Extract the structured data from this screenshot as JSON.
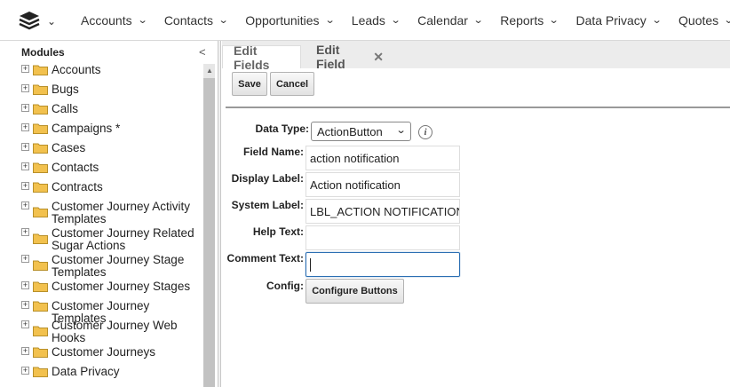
{
  "topnav": {
    "items": [
      {
        "label": "Accounts"
      },
      {
        "label": "Contacts"
      },
      {
        "label": "Opportunities"
      },
      {
        "label": "Leads"
      },
      {
        "label": "Calendar"
      },
      {
        "label": "Reports"
      },
      {
        "label": "Data Privacy"
      },
      {
        "label": "Quotes"
      }
    ],
    "logo_icon": "stack-layers-icon"
  },
  "modules": {
    "header": "Modules",
    "collapse_glyph": "<",
    "items": [
      {
        "label": "Accounts"
      },
      {
        "label": "Bugs"
      },
      {
        "label": "Calls"
      },
      {
        "label": "Campaigns *"
      },
      {
        "label": "Cases"
      },
      {
        "label": "Contacts"
      },
      {
        "label": "Contracts"
      },
      {
        "label": "Customer Journey Activity Templates"
      },
      {
        "label": "Customer Journey Related Sugar Actions"
      },
      {
        "label": "Customer Journey Stage Templates"
      },
      {
        "label": "Customer Journey Stages"
      },
      {
        "label": "Customer Journey Templates"
      },
      {
        "label": "Customer Journey Web Hooks"
      },
      {
        "label": "Customer Journeys"
      },
      {
        "label": "Data Privacy"
      }
    ]
  },
  "tabs": {
    "edit_fields": "Edit Fields",
    "edit_field": "Edit Field",
    "close_glyph": "✕"
  },
  "toolbar": {
    "save_label": "Save",
    "cancel_label": "Cancel"
  },
  "form": {
    "data_type": {
      "label": "Data Type:",
      "value": "ActionButton"
    },
    "field_name": {
      "label": "Field Name:",
      "value": "action notification"
    },
    "display_label": {
      "label": "Display Label:",
      "value": "Action notification"
    },
    "system_label": {
      "label": "System Label:",
      "value": "LBL_ACTION NOTIFICATION"
    },
    "help_text": {
      "label": "Help Text:",
      "value": ""
    },
    "comment_text": {
      "label": "Comment Text:",
      "value": ""
    },
    "config": {
      "label": "Config:",
      "button": "Configure Buttons"
    },
    "info_glyph": "i"
  },
  "colors": {
    "focus_border": "#2c6fb3",
    "tabbar_bg": "#ececec",
    "folder": "#f2c14e"
  }
}
